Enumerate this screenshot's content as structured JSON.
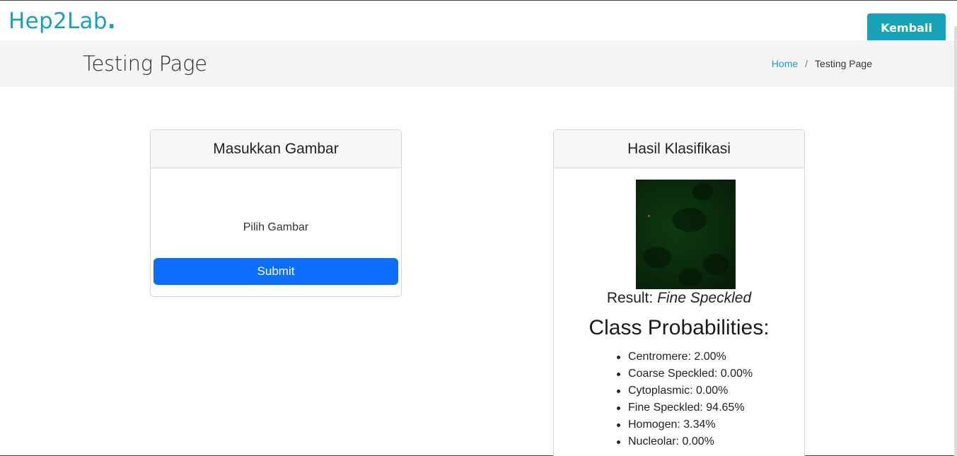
{
  "header": {
    "logo_text": "Hep2Lab",
    "logo_dot": ".",
    "back_button": "Kembali"
  },
  "titlebar": {
    "title": "Testing Page",
    "breadcrumb": {
      "home": "Home",
      "separator": "/",
      "current": "Testing Page"
    }
  },
  "upload_card": {
    "title": "Masukkan Gambar",
    "choose_label": "Pilih Gambar",
    "submit_label": "Submit"
  },
  "result_card": {
    "title": "Hasil Klasifikasi",
    "result_prefix": "Result:",
    "result_value": "Fine Speckled",
    "probabilities_title": "Class Probabilities:",
    "probabilities": [
      "Centromere: 2.00%",
      "Coarse Speckled: 0.00%",
      "Cytoplasmic: 0.00%",
      "Fine Speckled: 94.65%",
      "Homogen: 3.34%",
      "Nucleolar: 0.00%"
    ]
  },
  "colors": {
    "brand": "#1aa2bd",
    "back_button_bg": "#18a2b8",
    "submit_bg": "#0d6efd",
    "titlebar_bg": "#f4f4f4"
  }
}
